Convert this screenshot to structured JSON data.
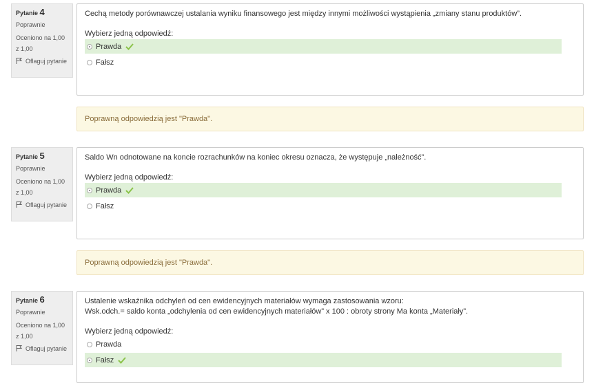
{
  "questions": [
    {
      "label": "Pytanie",
      "number": "4",
      "state": "Poprawnie",
      "grade": "Oceniono na 1,00 z 1,00",
      "flag": "Oflaguj pytanie",
      "text": "Cechą metody porównawczej ustalania wyniku finansowego jest między innymi możliwości wystąpienia „zmiany stanu produktów”.",
      "text2": "",
      "prompt": "Wybierz jedną odpowiedź:",
      "options": [
        {
          "label": "Prawda",
          "selected": true,
          "correct": true
        },
        {
          "label": "Fałsz",
          "selected": false,
          "correct": false
        }
      ],
      "feedback": "Poprawną odpowiedzią jest \"Prawda\"."
    },
    {
      "label": "Pytanie",
      "number": "5",
      "state": "Poprawnie",
      "grade": "Oceniono na 1,00 z 1,00",
      "flag": "Oflaguj pytanie",
      "text": "Saldo Wn odnotowane na koncie rozrachunków na koniec okresu oznacza, że występuje „należność”.",
      "text2": "",
      "prompt": "Wybierz jedną odpowiedź:",
      "options": [
        {
          "label": "Prawda",
          "selected": true,
          "correct": true
        },
        {
          "label": "Fałsz",
          "selected": false,
          "correct": false
        }
      ],
      "feedback": "Poprawną odpowiedzią jest \"Prawda\"."
    },
    {
      "label": "Pytanie",
      "number": "6",
      "state": "Poprawnie",
      "grade": "Oceniono na 1,00 z 1,00",
      "flag": "Oflaguj pytanie",
      "text": "Ustalenie wskaźnika odchyleń od cen ewidencyjnych materiałów wymaga zastosowania wzoru:",
      "text2": "Wsk.odch.= saldo konta „odchylenia od cen ewidencyjnych materiałów” x 100 : obroty strony Ma konta „Materiały”.",
      "prompt": "Wybierz jedną odpowiedź:",
      "options": [
        {
          "label": "Prawda",
          "selected": false,
          "correct": false
        },
        {
          "label": "Fałsz",
          "selected": true,
          "correct": true
        }
      ],
      "feedback": ""
    }
  ],
  "colors": {
    "correct_bg": "#dff0d8",
    "check": "#8bc34a",
    "feedback_bg": "#fcf8e3",
    "feedback_text": "#8a6d3b"
  }
}
